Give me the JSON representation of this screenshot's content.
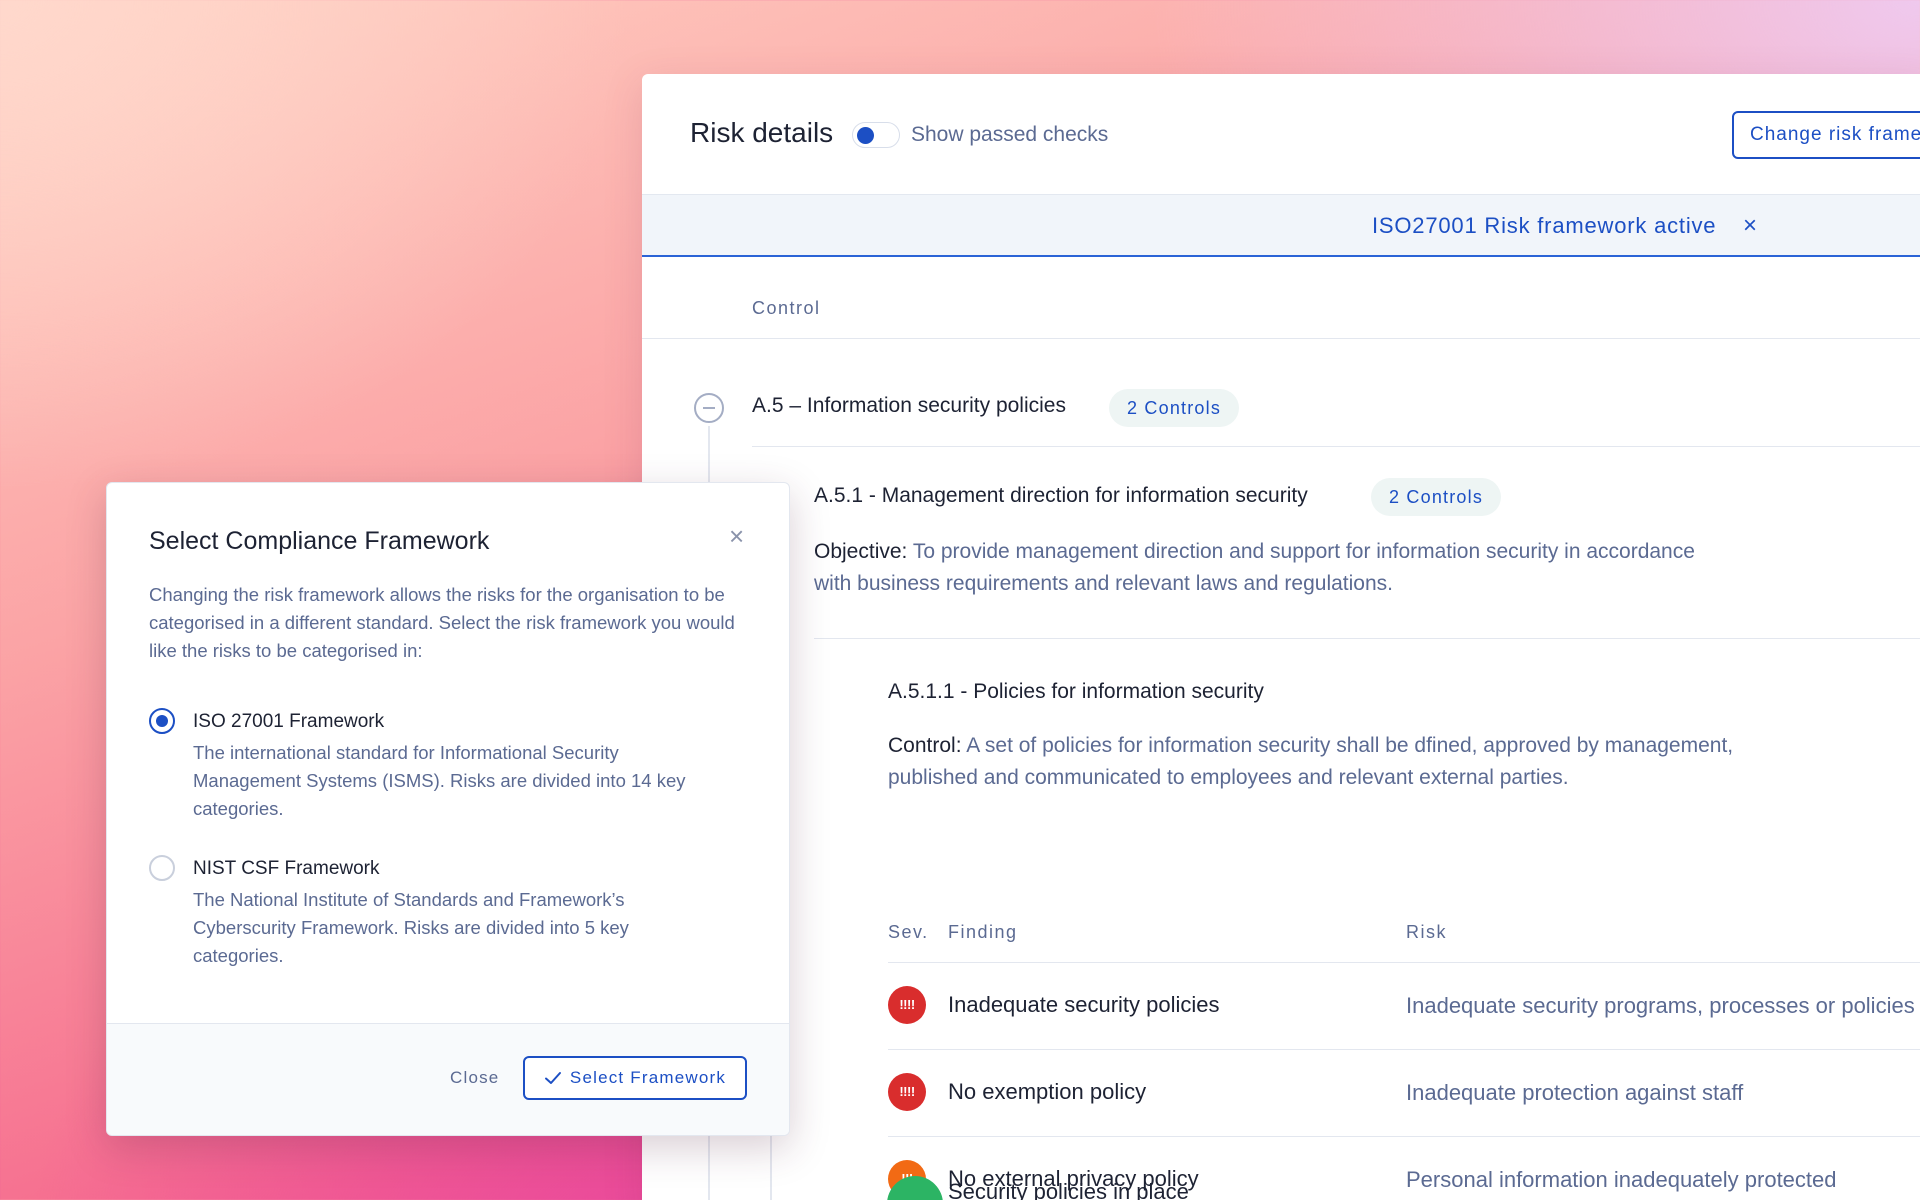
{
  "header": {
    "title": "Risk details",
    "toggle_label": "Show passed checks",
    "change_button": "Change risk framework"
  },
  "banner": {
    "text": "ISO27001 Risk framework active",
    "close_icon": "×"
  },
  "table": {
    "column_header": "Control"
  },
  "section": {
    "title": "A.5 – Information security policies",
    "chip": "2 Controls",
    "subsection": {
      "title": "A.5.1 - Management direction for information security",
      "chip": "2 Controls",
      "objective_label": "Objective:",
      "objective_text_line1": " To provide management direction and support for information security in accordance",
      "objective_text_line2": "with business requirements and relevant laws and regulations."
    },
    "control": {
      "title": "A.5.1.1 - Policies for information security",
      "label": "Control:",
      "text_line1": " A set of policies for information security shall be dfined, approved by management,",
      "text_line2": "published and communicated to employees and relevant external parties."
    }
  },
  "findings": {
    "headers": {
      "sev": "Sev.",
      "finding": "Finding",
      "risk": "Risk"
    },
    "rows": [
      {
        "sev_glyph": "!!!!",
        "sev_color": "#d92d2d",
        "finding": "Inadequate security policies",
        "risk": "Inadequate security programs, processes or policies"
      },
      {
        "sev_glyph": "!!!!",
        "sev_color": "#d92d2d",
        "finding": "No exemption policy",
        "risk": "Inadequate protection against staff"
      },
      {
        "sev_glyph": "!!!",
        "sev_color": "#f26a14",
        "finding": "No external privacy policy",
        "risk": "Personal information inadequately protected"
      },
      {
        "sev_glyph": "",
        "sev_color": "#2cb464",
        "finding": "Security policies in place",
        "risk": ""
      }
    ]
  },
  "modal": {
    "title": "Select Compliance Framework",
    "close_icon": "×",
    "description": "Changing the risk framework allows the risks for the organisation to be categorised in a different standard. Select the risk framework you would like the risks to be categorised in:",
    "options": [
      {
        "title": "ISO 27001 Framework",
        "description": "The international standard for Informational Security Management Systems (ISMS). Risks are divided into 14 key categories.",
        "selected": true
      },
      {
        "title": "NIST CSF Framework",
        "description": "The National Institute of Standards and Framework’s Cyberscurity Framework. Risks are divided into 5 key categories.",
        "selected": false
      }
    ],
    "close_button": "Close",
    "select_button": "Select Framework"
  },
  "colors": {
    "accent": "#1c4fc4",
    "critical": "#d92d2d",
    "high": "#f26a14",
    "pass": "#2cb464"
  }
}
